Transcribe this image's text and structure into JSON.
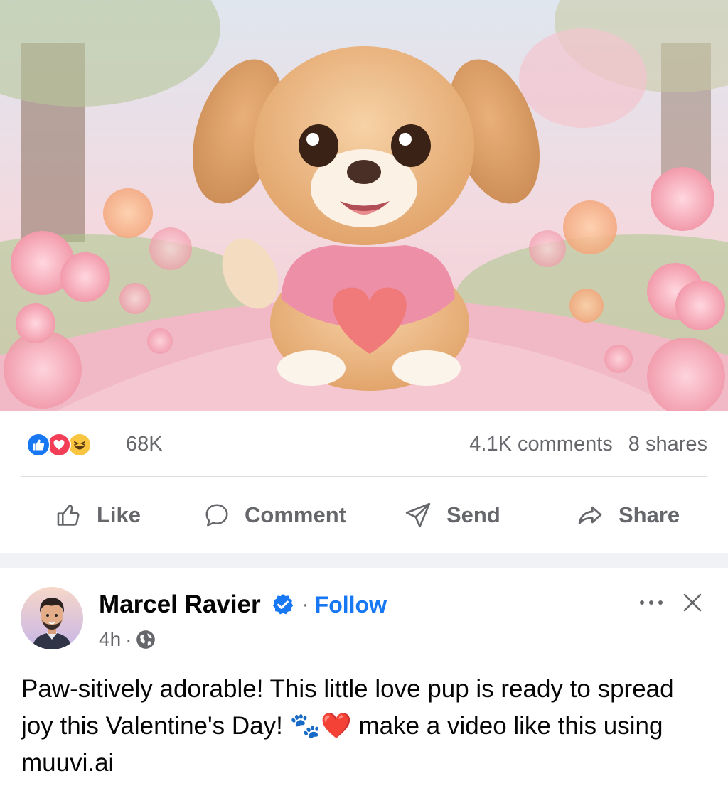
{
  "stats": {
    "reaction_count": "68K",
    "comments": "4.1K comments",
    "shares": "8 shares",
    "reactions": [
      "like-icon",
      "love-icon",
      "haha-icon"
    ]
  },
  "actions": {
    "like": "Like",
    "comment": "Comment",
    "send": "Send",
    "share": "Share"
  },
  "post": {
    "author": "Marcel Ravier",
    "separator": "·",
    "follow": "Follow",
    "time": "4h",
    "audience_icon": "globe-icon",
    "text": "Paw-sitively adorable! This little love pup is ready to spread joy this Valentine's Day! 🐾❤️ make a video like this using muuvi.ai"
  },
  "colors": {
    "brand_blue": "#1877f2",
    "muted_text": "#65676b",
    "love_red": "#f33e58",
    "haha_yellow": "#f7c53f"
  }
}
